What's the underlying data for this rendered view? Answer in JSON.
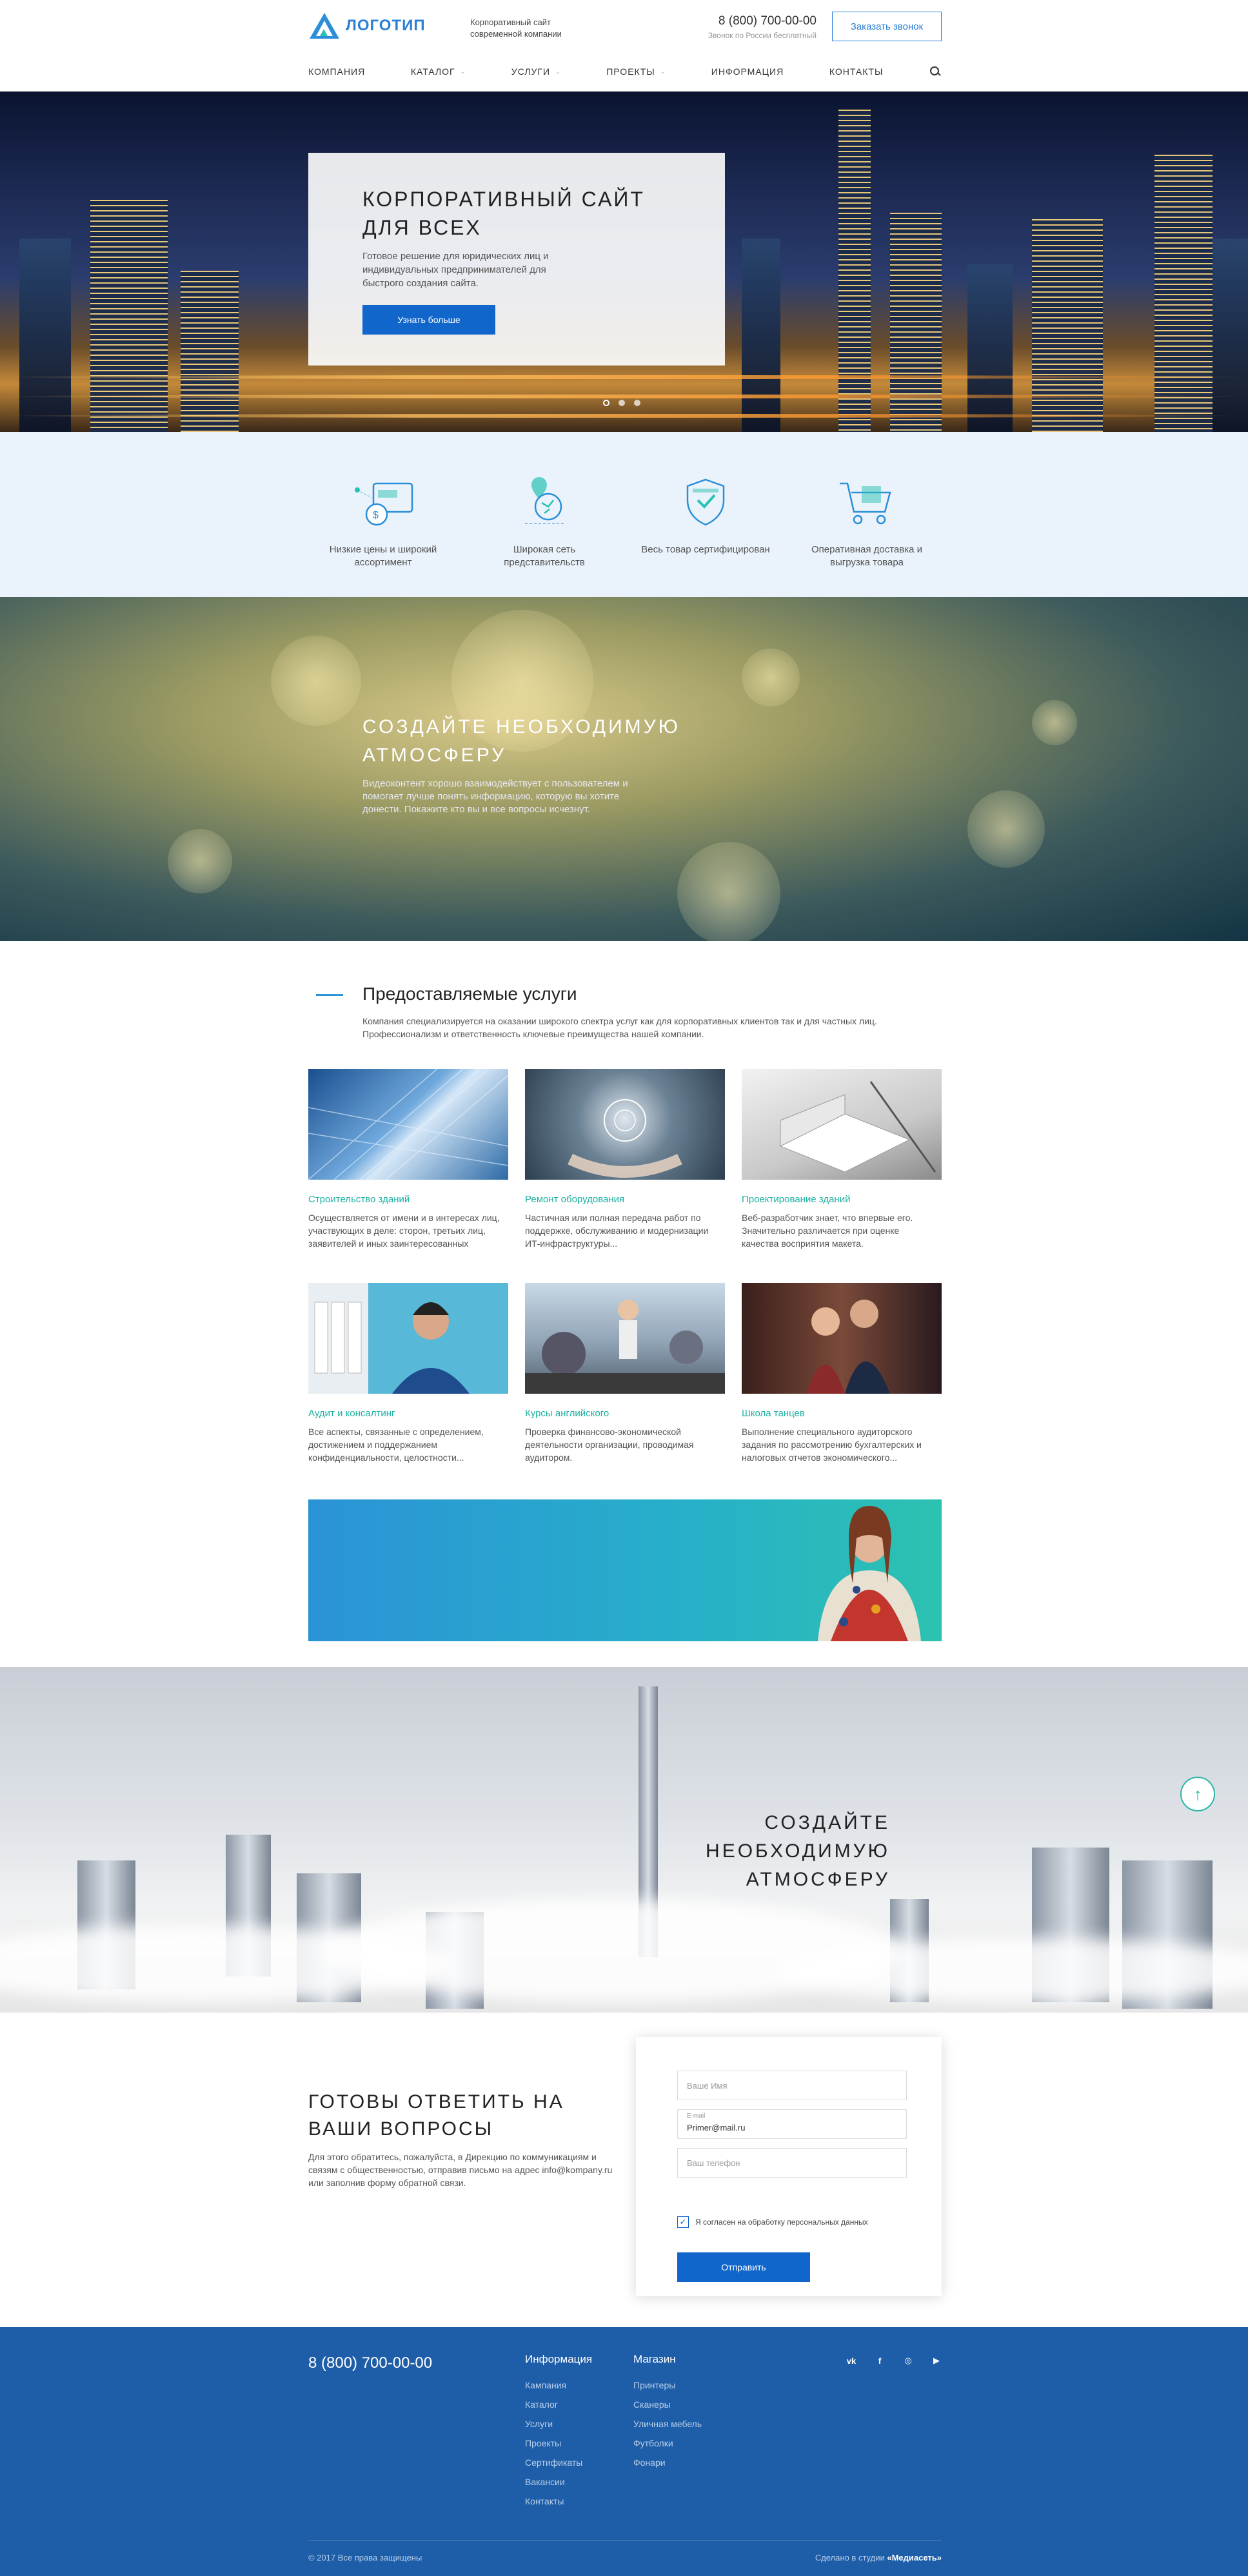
{
  "header": {
    "logo_text": "ЛОГОТИП",
    "tagline": "Корпоративный сайт современной компании",
    "phone": "8 (800) 700-00-00",
    "phone_note": "Звонок по России бесплатный",
    "callback_label": "Заказать звонок"
  },
  "nav": {
    "items": [
      {
        "label": "КОМПАНИЯ",
        "has_dropdown": false
      },
      {
        "label": "КАТАЛОГ",
        "has_dropdown": true
      },
      {
        "label": "УСЛУГИ",
        "has_dropdown": true
      },
      {
        "label": "ПРОЕКТЫ",
        "has_dropdown": true
      },
      {
        "label": "ИНФОРМАЦИЯ",
        "has_dropdown": false
      },
      {
        "label": "КОНТАКТЫ",
        "has_dropdown": false
      }
    ],
    "search_icon": "search-icon"
  },
  "hero": {
    "title": "КОРПОРАТИВНЫЙ САЙТ ДЛЯ ВСЕХ",
    "text": "Готовое решение для юридических лиц и индивидуальных предпринимателей для быстрого создания сайта.",
    "button": "Узнать больше",
    "slides": 3,
    "active_slide": 1
  },
  "features": [
    {
      "label": "Низкие цены и широкий ассортимент",
      "icon": "wallet-icon"
    },
    {
      "label": "Широкая сеть представительств",
      "icon": "map-pin-icon"
    },
    {
      "label": "Весь товар сертифицирован",
      "icon": "shield-icon"
    },
    {
      "label": "Оперативная доставка и выгрузка товара",
      "icon": "cart-icon"
    }
  ],
  "atmosphere1": {
    "title": "СОЗДАЙТЕ НЕОБХОДИМУЮ АТМОСФЕРУ",
    "text": "Видеоконтент хорошо взаимодействует с пользователем и помогает лучше понять информацию, которую вы хотите донести. Покажите кто вы и все вопросы исчезнут."
  },
  "services": {
    "title": "Предоставляемые услуги",
    "description": "Компания специализируется на оказании широкого спектра услуг как для корпоративных клиентов так и для частных лиц. Профессионализм и ответственность ключевые преимущества нашей компании.",
    "items": [
      {
        "title": "Строительство зданий",
        "text": "Осуществляется от имени и в интересах лиц, участвующих в деле: сторон, третьих лиц, заявителей и иных заинтересованных"
      },
      {
        "title": "Ремонт оборудования",
        "text": "Частичная или полная передача работ по поддержке, обслуживанию и модернизации ИТ-инфраструктуры..."
      },
      {
        "title": "Проектирование зданий",
        "text": "Веб-разработчик знает, что впервые его. Значительно различается при оценке качества восприятия макета."
      },
      {
        "title": "Аудит и консалтинг",
        "text": "Все аспекты, связанные с определением, достижением и поддержанием конфиденциальности, целостности..."
      },
      {
        "title": "Курсы английского",
        "text": "Проверка финансово-экономической деятельности организации, проводимая аудитором."
      },
      {
        "title": "Школа танцев",
        "text": "Выполнение специального аудиторского задания по рассмотрению бухгалтерских и налоговых отчетов экономического..."
      }
    ]
  },
  "atmosphere2": {
    "title": "СОЗДАЙТЕ НЕОБХОДИМУЮ АТМОСФЕРУ",
    "scroll_top_icon": "arrow-up-icon"
  },
  "contact": {
    "title": "ГОТОВЫ ОТВЕТИТЬ НА ВАШИ ВОПРОСЫ",
    "text": "Для этого обратитесь, пожалуйста, в Дирекцию по коммуникациям и связям с общественностью, отправив письмо на адрес info@kompany.ru или заполнив форму обратной связи.",
    "form": {
      "name_placeholder": "Ваше Имя",
      "email_label": "E-mail",
      "email_value": "Primer@mail.ru",
      "phone_placeholder": "Ваш телефон",
      "consent_label": "Я согласен на обработку персональных данных",
      "consent_checked": true,
      "submit_label": "Отправить"
    }
  },
  "footer": {
    "phone": "8 (800) 700-00-00",
    "info_title": "Информация",
    "info_links": [
      "Кампания",
      "Каталог",
      "Услуги",
      "Проекты",
      "Сертификаты",
      "Вакансии",
      "Контакты"
    ],
    "shop_title": "Магазин",
    "shop_links": [
      "Принтеры",
      "Сканеры",
      "Уличная мебель",
      "Футболки",
      "Фонари"
    ],
    "socials": [
      {
        "icon": "vk-icon",
        "glyph": "vk"
      },
      {
        "icon": "facebook-icon",
        "glyph": "f"
      },
      {
        "icon": "instagram-icon",
        "glyph": "◎"
      },
      {
        "icon": "youtube-icon",
        "glyph": "▶"
      }
    ],
    "copyright": "© 2017 Все права защищены",
    "made_by_prefix": "Сделано в студии",
    "made_by_studio": "«Медиасеть»"
  },
  "colors": {
    "accent": "#1166cc",
    "teal": "#1ab0a0",
    "footer_bg": "#1e5ea8",
    "features_bg": "#eaf2fb"
  }
}
